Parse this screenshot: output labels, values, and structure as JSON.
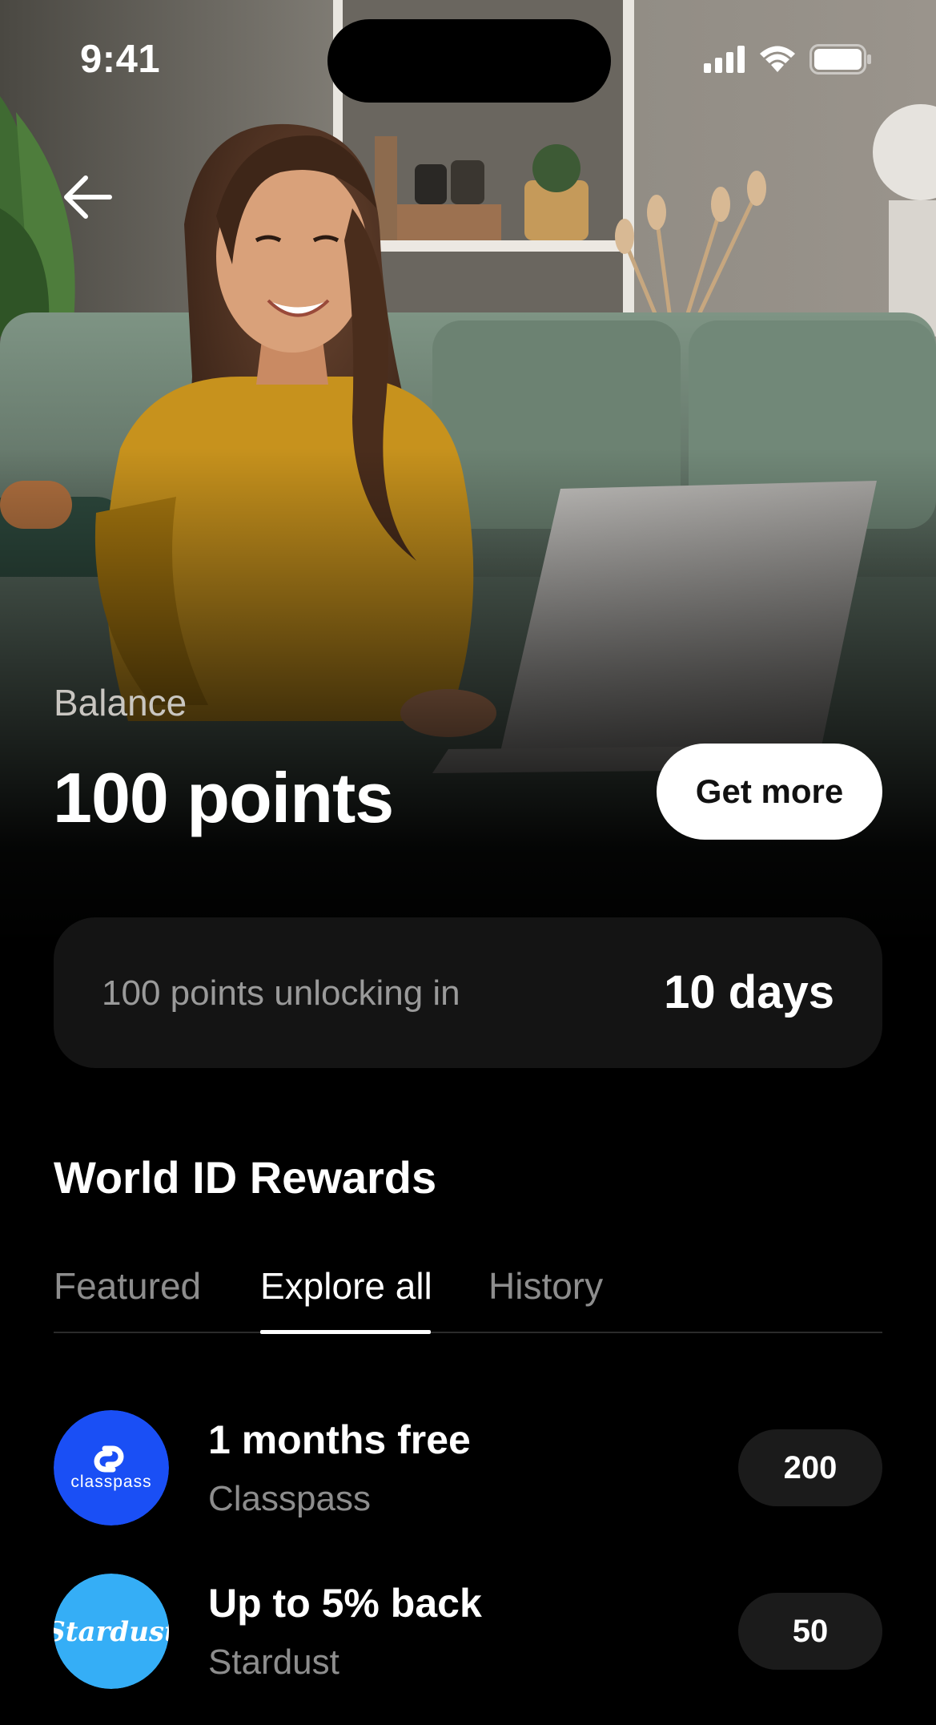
{
  "status_bar": {
    "time": "9:41",
    "icons": [
      "signal-icon",
      "wifi-icon",
      "battery-icon"
    ]
  },
  "header": {
    "back_icon": "arrow-left-icon"
  },
  "balance": {
    "label": "Balance",
    "value": "100 points",
    "get_more_label": "Get more"
  },
  "unlock": {
    "text": "100 points unlocking in",
    "value": "10 days"
  },
  "rewards": {
    "title": "World ID Rewards",
    "tabs": [
      {
        "label": "Featured",
        "active": false
      },
      {
        "label": "Explore all",
        "active": true
      },
      {
        "label": "History",
        "active": false
      }
    ],
    "items": [
      {
        "title": "1 months free",
        "brand": "Classpass",
        "cost": "200",
        "logo_color": "#1a4ff5",
        "logo_text": "classpass"
      },
      {
        "title": "Up to 5% back",
        "brand": "Stardust",
        "cost": "50",
        "logo_color": "#35aef6",
        "logo_text": "Stardust"
      }
    ]
  },
  "colors": {
    "background": "#000000",
    "card": "#141414",
    "pill": "#1b1b1b",
    "muted_text": "#8d8d8d",
    "accent_white": "#ffffff"
  }
}
